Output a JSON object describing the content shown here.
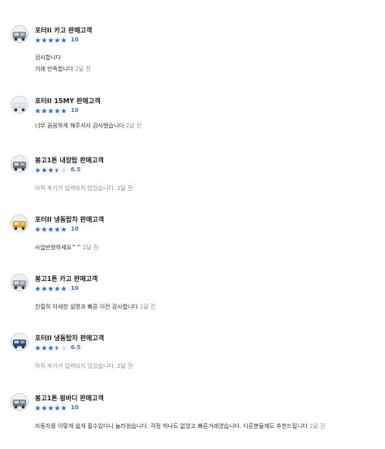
{
  "top_cut_text": "· ·· ·· · ·  ·· ·· ·· ·",
  "reviews": [
    {
      "seller": "포터II 카고 판매고객",
      "stars": 5,
      "score": "10",
      "avatar_color": "#7a8592",
      "lines": [
        "검사합니다",
        "거래 만족합니다"
      ],
      "ago": "2달 전"
    },
    {
      "seller": "포터II 15MY 판매고객",
      "stars": 5,
      "score": "10",
      "avatar_color": "#d9dde2",
      "lines": [
        "너무 꼼꼼하게 해주셔서 감사했습니다"
      ],
      "ago": "2달 전"
    },
    {
      "seller": "봉고1톤 내장탑 판매고객",
      "stars": 3.5,
      "score": "6.5",
      "avatar_color": "#6b7480",
      "lines": [
        "아직 후기가 입력되지 않았습니다."
      ],
      "ago": "2달 전",
      "placeholder": true
    },
    {
      "seller": "포터II 냉동탑차 판매고객",
      "stars": 5,
      "score": "10",
      "avatar_color": "#d9a21b",
      "lines": [
        "사업번창하세요^^"
      ],
      "ago": "2달 전"
    },
    {
      "seller": "봉고1톤 카고 판매고객",
      "stars": 5,
      "score": "10",
      "avatar_color": "#8c96a2",
      "lines": [
        "친절히 자세한 설명과 빠른 이전 감사합니다"
      ],
      "ago": "2달 전"
    },
    {
      "seller": "포터II 냉동탑차 판매고객",
      "stars": 3.5,
      "score": "6.5",
      "avatar_color": "#2d4a7a",
      "lines": [
        "아직 후기가 입력되지 않았습니다."
      ],
      "ago": "2달 전",
      "placeholder": true
    },
    {
      "seller": "봉고1톤 윙바디 판매고객",
      "stars": 5,
      "score": "10",
      "avatar_color": "#707a86",
      "lines": [
        "자동차를 이렇게 쉽게 팔수있다니 놀라웠습니다. 걱정 하나도 없었고 빠른거래였습니다. 다른분들께도 추천드립니다"
      ],
      "ago": "2달 전"
    }
  ],
  "colors": {
    "star_on": "#3b6fd8",
    "star_off": "#d5dae0"
  }
}
